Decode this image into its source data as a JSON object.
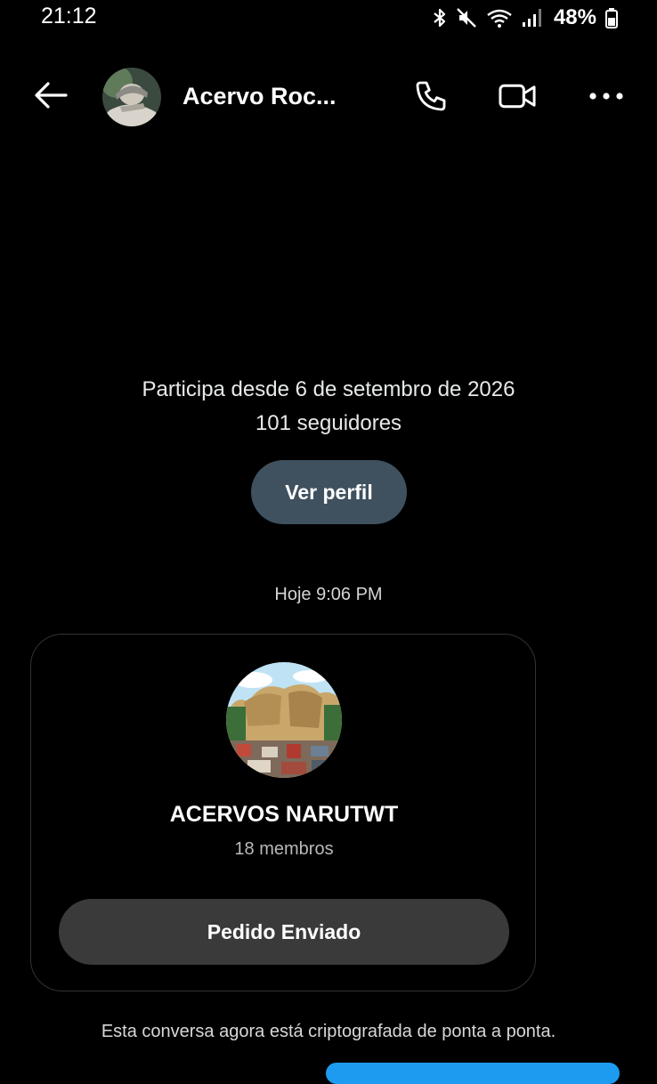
{
  "status_bar": {
    "time": "21:12",
    "battery_percent": "48%",
    "icons": [
      "bluetooth-icon",
      "mute-icon",
      "wifi-icon",
      "signal-icon",
      "battery-icon"
    ]
  },
  "header": {
    "chat_name": "Acervo Roc...",
    "icons": [
      "back-arrow-icon",
      "phone-icon",
      "video-camera-icon",
      "more-icon"
    ]
  },
  "profile_info": {
    "member_since": "Participa desde 6 de setembro de 2026",
    "followers": "101 seguidores",
    "view_profile_label": "Ver perfil"
  },
  "messages": {
    "timestamp": "Hoje 9:06 PM",
    "group_invite": {
      "group_name": "ACERVOS NARUTWT",
      "members": "18 membros",
      "button_label": "Pedido Enviado"
    },
    "encryption_notice": "Esta conversa agora está criptografada de ponta a ponta."
  },
  "colors": {
    "background": "#000000",
    "profile_button": "#3f515f",
    "request_button": "#3a3a3a",
    "accent": "#1d9bf0"
  }
}
